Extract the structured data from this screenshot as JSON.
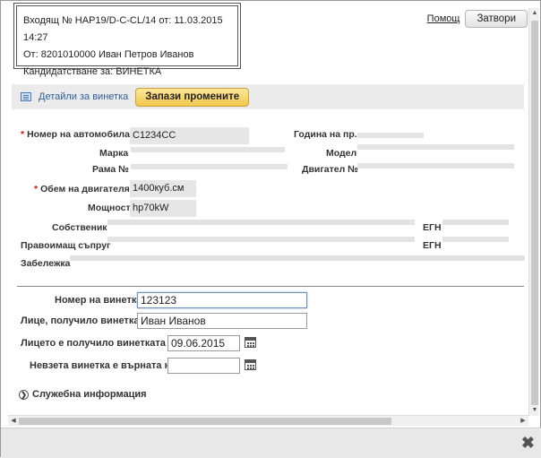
{
  "header": {
    "line1": "Входящ № НАР19/D-C-CL/14 от: 11.03.2015 14:27",
    "line2": "От: 8201010000 Иван Петров Иванов",
    "line3": "Кандидатстване за: ВИНЕТКА"
  },
  "top": {
    "help_label": "Помощ",
    "close_label": "Затвори"
  },
  "toolbar": {
    "details_label": "Детайли за винетка",
    "save_label": "Запази промените"
  },
  "vehicle": {
    "plate_label": "Номер на автомобила",
    "plate_value": "С1234СС",
    "year_label": "Година на пр.",
    "make_label": "Марка",
    "model_label": "Модел",
    "frame_label": "Рама №",
    "engine_label": "Двигател №",
    "volume_label": "Обем на двигателя",
    "volume_value": "1400куб.см",
    "power_label": "Мощност",
    "power_value": "hp70kW",
    "owner_label": "Собственик",
    "egn_label": "ЕГН",
    "spouse_label": "Правоимащ съпруг",
    "egn2_label": "ЕГН",
    "note_label": "Забележка"
  },
  "vignette": {
    "number_label": "Номер на винетка",
    "number_value": "123123",
    "person_label": "Лице, получило винетката",
    "person_value": "Иван Иванов",
    "received_label": "Лицето е получило винетката на",
    "received_value": "09.06.2015",
    "returned_label": "Невзета винетка е върната на",
    "returned_value": ""
  },
  "service_info_label": "Служебна информация",
  "colors": {
    "accent": "#f2c84b",
    "link": "#2f5f9a",
    "required": "#dd1111"
  }
}
